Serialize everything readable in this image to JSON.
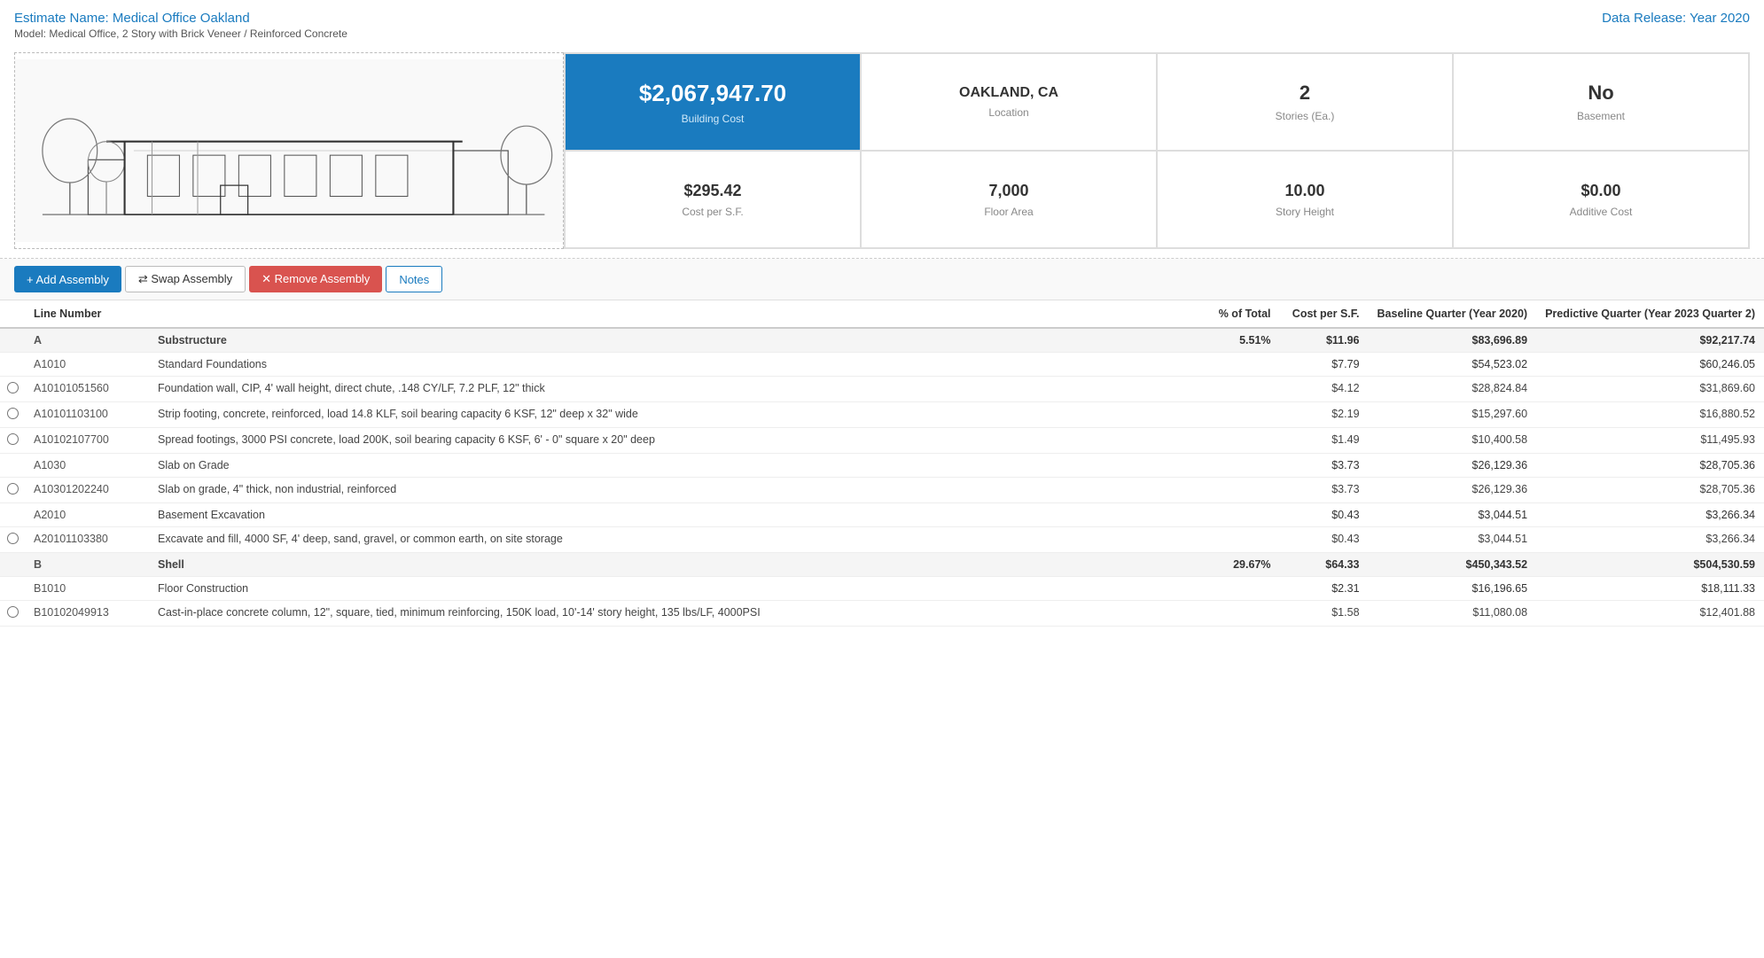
{
  "header": {
    "estimate_label": "Estimate Name:",
    "estimate_name": "Medical Office Oakland",
    "model_label": "Model: Medical Office, 2 Story with Brick Veneer / Reinforced Concrete",
    "data_release_label": "Data Release:",
    "data_release_year": "Year 2020"
  },
  "summary": {
    "building_cost_value": "$2,067,947.70",
    "building_cost_label": "Building Cost",
    "location_value": "OAKLAND, CA",
    "location_label": "Location",
    "stories_value": "2",
    "stories_label": "Stories (Ea.)",
    "basement_value": "No",
    "basement_label": "Basement",
    "cost_per_sf_value": "$295.42",
    "cost_per_sf_label": "Cost per S.F.",
    "floor_area_value": "7,000",
    "floor_area_label": "Floor Area",
    "story_height_value": "10.00",
    "story_height_label": "Story Height",
    "additive_cost_value": "$0.00",
    "additive_cost_label": "Additive Cost"
  },
  "toolbar": {
    "add_assembly": "+ Add Assembly",
    "swap_assembly": "⇄ Swap Assembly",
    "remove_assembly": "✕ Remove Assembly",
    "notes": "Notes"
  },
  "table": {
    "columns": [
      "Line Number",
      "% of Total",
      "Cost per S.F.",
      "Baseline Quarter (Year 2020)",
      "Predictive Quarter (Year 2023 Quarter 2)"
    ],
    "rows": [
      {
        "type": "section",
        "code": "A",
        "desc": "Substructure",
        "pct": "5.51%",
        "cost_sf": "$11.96",
        "baseline": "$83,696.89",
        "predictive": "$92,217.74"
      },
      {
        "type": "subsection",
        "code": "A1010",
        "desc": "Standard Foundations",
        "cost_sf": "$7.79",
        "baseline": "$54,523.02",
        "predictive": "$60,246.05"
      },
      {
        "type": "item",
        "radio": true,
        "code": "A10101051560",
        "desc": "Foundation wall, CIP, 4' wall height, direct chute, .148 CY/LF, 7.2 PLF, 12\" thick",
        "cost_sf": "$4.12",
        "baseline": "$28,824.84",
        "predictive": "$31,869.60"
      },
      {
        "type": "item",
        "radio": true,
        "code": "A10101103100",
        "desc": "Strip footing, concrete, reinforced, load 14.8 KLF, soil bearing capacity 6 KSF, 12\" deep x 32\" wide",
        "cost_sf": "$2.19",
        "baseline": "$15,297.60",
        "predictive": "$16,880.52"
      },
      {
        "type": "item",
        "radio": true,
        "code": "A10102107700",
        "desc": "Spread footings, 3000 PSI concrete, load 200K, soil bearing capacity 6 KSF, 6' - 0\" square x 20\" deep",
        "cost_sf": "$1.49",
        "baseline": "$10,400.58",
        "predictive": "$11,495.93"
      },
      {
        "type": "subsection",
        "code": "A1030",
        "desc": "Slab on Grade",
        "cost_sf": "$3.73",
        "baseline": "$26,129.36",
        "predictive": "$28,705.36"
      },
      {
        "type": "item",
        "radio": true,
        "code": "A10301202240",
        "desc": "Slab on grade, 4\" thick, non industrial, reinforced",
        "cost_sf": "$3.73",
        "baseline": "$26,129.36",
        "predictive": "$28,705.36"
      },
      {
        "type": "subsection",
        "code": "A2010",
        "desc": "Basement Excavation",
        "cost_sf": "$0.43",
        "baseline": "$3,044.51",
        "predictive": "$3,266.34"
      },
      {
        "type": "item",
        "radio": true,
        "code": "A20101103380",
        "desc": "Excavate and fill, 4000 SF, 4' deep, sand, gravel, or common earth, on site storage",
        "cost_sf": "$0.43",
        "baseline": "$3,044.51",
        "predictive": "$3,266.34"
      },
      {
        "type": "section",
        "code": "B",
        "desc": "Shell",
        "pct": "29.67%",
        "cost_sf": "$64.33",
        "baseline": "$450,343.52",
        "predictive": "$504,530.59"
      },
      {
        "type": "subsection",
        "code": "B1010",
        "desc": "Floor Construction",
        "cost_sf": "$2.31",
        "baseline": "$16,196.65",
        "predictive": "$18,111.33"
      },
      {
        "type": "item",
        "radio": true,
        "code": "B10102049913",
        "desc": "Cast-in-place concrete column, 12\", square, tied, minimum reinforcing, 150K load, 10'-14' story height, 135 lbs/LF, 4000PSI",
        "cost_sf": "$1.58",
        "baseline": "$11,080.08",
        "predictive": "$12,401.88"
      }
    ]
  }
}
